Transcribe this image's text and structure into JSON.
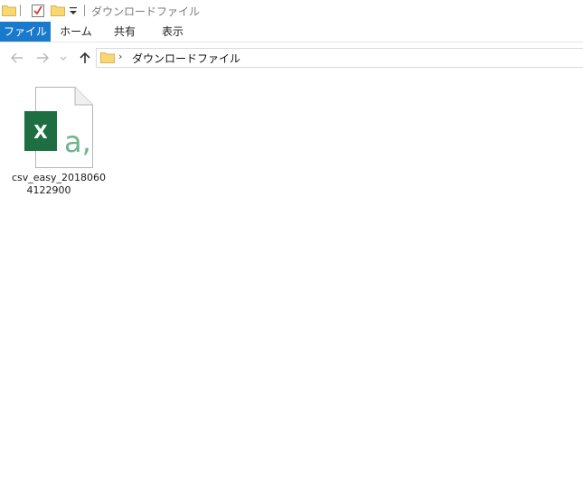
{
  "window": {
    "title": "ダウンロードファイル"
  },
  "ribbon": {
    "tabs": [
      {
        "label": "ファイル",
        "active": true
      },
      {
        "label": "ホーム"
      },
      {
        "label": "共有"
      },
      {
        "label": "表示"
      }
    ]
  },
  "navigation": {
    "address_path": "ダウンロードファイル",
    "chevron": "›"
  },
  "files": [
    {
      "name_line1": "csv_easy_2018060",
      "name_line2": "4122900",
      "icon": "excel-csv-icon",
      "icon_letter": "X",
      "icon_glyph": "a,"
    }
  ],
  "colors": {
    "accent": "#1979ca",
    "excel_green": "#1d6f42",
    "excel_light": "#6fb38c",
    "folder_yellow": "#f8d775"
  }
}
